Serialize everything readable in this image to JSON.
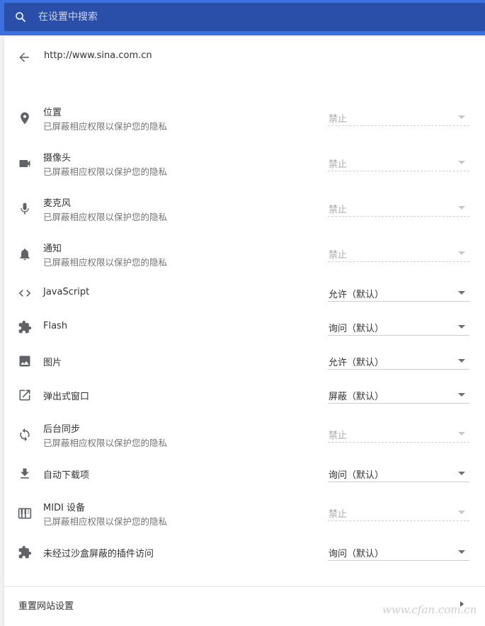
{
  "search": {
    "placeholder": "在设置中搜索"
  },
  "header": {
    "url": "http://www.sina.com.cn"
  },
  "permissions": [
    {
      "title": "位置",
      "subtitle": "已屏蔽相应权限以保护您的隐私",
      "value": "禁止",
      "icon": "location-pin-icon",
      "disabled": true
    },
    {
      "title": "摄像头",
      "subtitle": "已屏蔽相应权限以保护您的隐私",
      "value": "禁止",
      "icon": "camera-icon",
      "disabled": true
    },
    {
      "title": "麦克风",
      "subtitle": "已屏蔽相应权限以保护您的隐私",
      "value": "禁止",
      "icon": "microphone-icon",
      "disabled": true
    },
    {
      "title": "通知",
      "subtitle": "已屏蔽相应权限以保护您的隐私",
      "value": "禁止",
      "icon": "bell-icon",
      "disabled": true
    },
    {
      "title": "JavaScript",
      "value": "允许（默认）",
      "icon": "code-icon",
      "disabled": false
    },
    {
      "title": "Flash",
      "value": "询问（默认）",
      "icon": "puzzle-icon",
      "disabled": false
    },
    {
      "title": "图片",
      "value": "允许（默认）",
      "icon": "image-icon",
      "disabled": false
    },
    {
      "title": "弹出式窗口",
      "value": "屏蔽（默认）",
      "icon": "open-in-new-icon",
      "disabled": false
    },
    {
      "title": "后台同步",
      "subtitle": "已屏蔽相应权限以保护您的隐私",
      "value": "禁止",
      "icon": "sync-icon",
      "disabled": true
    },
    {
      "title": "自动下载项",
      "value": "询问（默认）",
      "icon": "download-icon",
      "disabled": false
    },
    {
      "title": "MIDI 设备",
      "subtitle": "已屏蔽相应权限以保护您的隐私",
      "value": "禁止",
      "icon": "piano-icon",
      "disabled": true
    },
    {
      "title": "未经过沙盒屏蔽的插件访问",
      "value": "询问（默认）",
      "icon": "puzzle-icon",
      "disabled": false
    }
  ],
  "reset": {
    "label": "重置网站设置"
  },
  "watermark": "www.cfan.com.cn"
}
